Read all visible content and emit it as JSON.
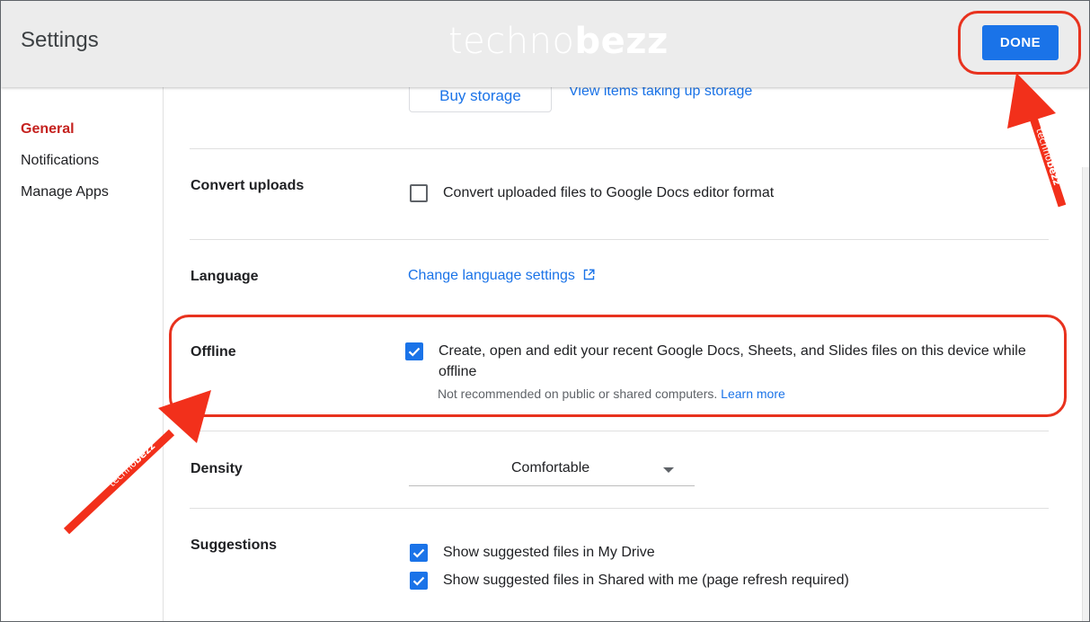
{
  "header": {
    "title": "Settings",
    "watermark_light": "techno",
    "watermark_bold": "bezz",
    "done_label": "DONE"
  },
  "sidebar": {
    "items": [
      {
        "label": "General",
        "active": true
      },
      {
        "label": "Notifications",
        "active": false
      },
      {
        "label": "Manage Apps",
        "active": false
      }
    ]
  },
  "storage": {
    "buy_label": "Buy storage",
    "view_items_label": "View items taking up storage"
  },
  "convert_uploads": {
    "label": "Convert uploads",
    "checkbox_label": "Convert uploaded files to Google Docs editor format",
    "checked": false
  },
  "language": {
    "label": "Language",
    "link_label": "Change language settings"
  },
  "offline": {
    "label": "Offline",
    "checkbox_label_line1": "Create, open and edit your recent Google Docs, Sheets, and Slides files on this device while",
    "checkbox_label_line2": "offline",
    "note": "Not recommended on public or shared computers.",
    "learn_more": "Learn more",
    "checked": true
  },
  "density": {
    "label": "Density",
    "value": "Comfortable"
  },
  "suggestions": {
    "label": "Suggestions",
    "items": [
      {
        "label": "Show suggested files in My Drive",
        "checked": true
      },
      {
        "label": "Show suggested files in Shared with me (page refresh required)",
        "checked": true
      }
    ]
  },
  "annotations": {
    "arrow_watermark_light": "techno",
    "arrow_watermark_bold": "bezz",
    "highlight_color": "#e8321e"
  },
  "colors": {
    "accent": "#1a73e8",
    "active_nav": "#c5221f",
    "header_bg": "#ececec"
  }
}
